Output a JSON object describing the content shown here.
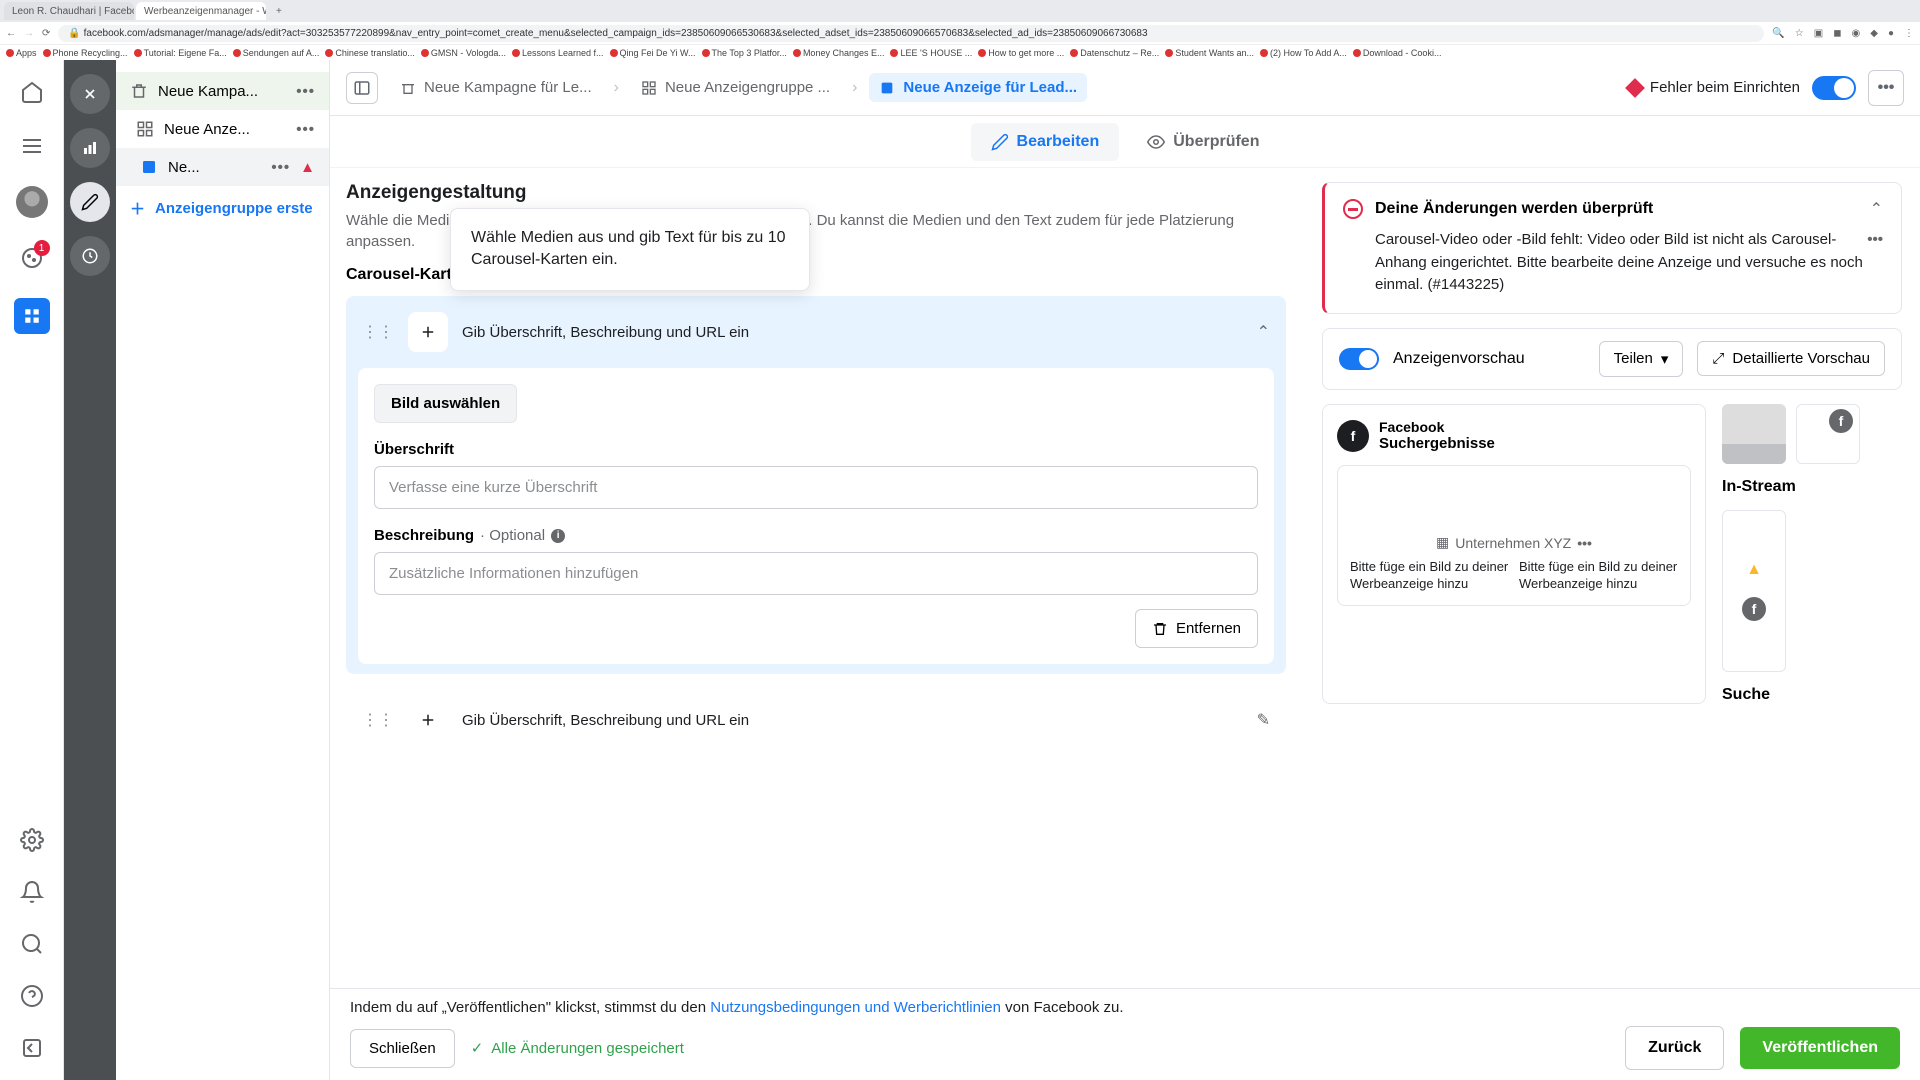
{
  "browser": {
    "tabs": [
      {
        "title": "Leon R. Chaudhari | Facebook"
      },
      {
        "title": "Werbeanzeigenmanager - We..."
      }
    ],
    "url": "facebook.com/adsmanager/manage/ads/edit?act=303253577220899&nav_entry_point=comet_create_menu&selected_campaign_ids=23850609066530683&selected_adset_ids=23850609066570683&selected_ad_ids=23850609066730683",
    "bookmarks": [
      "Apps",
      "Phone Recycling...",
      "Tutorial: Eigene Fa...",
      "Sendungen auf A...",
      "Chinese translatio...",
      "GMSN - Vologda...",
      "Lessons Learned f...",
      "Qing Fei De Yi W...",
      "The Top 3 Platfor...",
      "Money Changes E...",
      "LEE 'S HOUSE ...",
      "How to get more ...",
      "Datenschutz – Re...",
      "Student Wants an...",
      "(2) How To Add A...",
      "Download - Cooki..."
    ]
  },
  "rail": {
    "cookie_badge": "1"
  },
  "tree": {
    "items": [
      {
        "label": "Neue Kampa..."
      },
      {
        "label": "Neue Anze..."
      },
      {
        "label": "Ne..."
      }
    ],
    "add": "Anzeigengruppe erste"
  },
  "crumbs": {
    "c1": "Neue Kampagne für Le...",
    "c2": "Neue Anzeigengruppe ...",
    "c3": "Neue Anzeige für Lead...",
    "error": "Fehler beim Einrichten"
  },
  "modes": {
    "edit": "Bearbeiten",
    "review": "Überprüfen"
  },
  "editor": {
    "heading": "Anzeigengestaltung",
    "sub": "Wähle die Medien, den Text und das Ziel für deine Werbeanzeige aus. Du kannst die Medien und den Text zudem für jede Platzierung anpassen.",
    "tooltip": "Wähle Medien aus und gib Text für bis zu 10 Carousel-Karten ein.",
    "cards_title": "Carousel-Karten",
    "card_head": "Gib Überschrift, Beschreibung und URL ein",
    "select_image": "Bild auswählen",
    "headline_label": "Überschrift",
    "headline_ph": "Verfasse eine kurze Überschrift",
    "desc_label": "Beschreibung",
    "optional": "· Optional",
    "desc_ph": "Zusätzliche Informationen hinzufügen",
    "remove": "Entfernen",
    "card2_head": "Gib Überschrift, Beschreibung und URL ein"
  },
  "alert": {
    "title": "Deine Änderungen werden überprüft",
    "body": "Carousel-Video oder -Bild fehlt: Video oder Bild ist nicht als Carousel-Anhang eingerichtet. Bitte bearbeite deine Anzeige und versuche es noch einmal. (#1443225)"
  },
  "preview": {
    "label": "Anzeigenvorschau",
    "share": "Teilen",
    "detail": "Detaillierte Vorschau",
    "mock_brand": "Facebook",
    "mock_sub": "Suchergebnisse",
    "company": "Unternehmen XYZ",
    "tile_text": "Bitte füge ein Bild zu deiner Werbeanzeige hinzu",
    "instream": "In-Stream",
    "suche": "Suche"
  },
  "footer": {
    "text_a": "Indem du auf „Veröffentlichen\" klickst, stimmst du den ",
    "text_link": "Nutzungsbedingungen und Werberichtlinien",
    "text_b": " von Facebook zu.",
    "close": "Schließen",
    "saved": "Alle Änderungen gespeichert",
    "back": "Zurück",
    "publish": "Veröffentlichen"
  }
}
